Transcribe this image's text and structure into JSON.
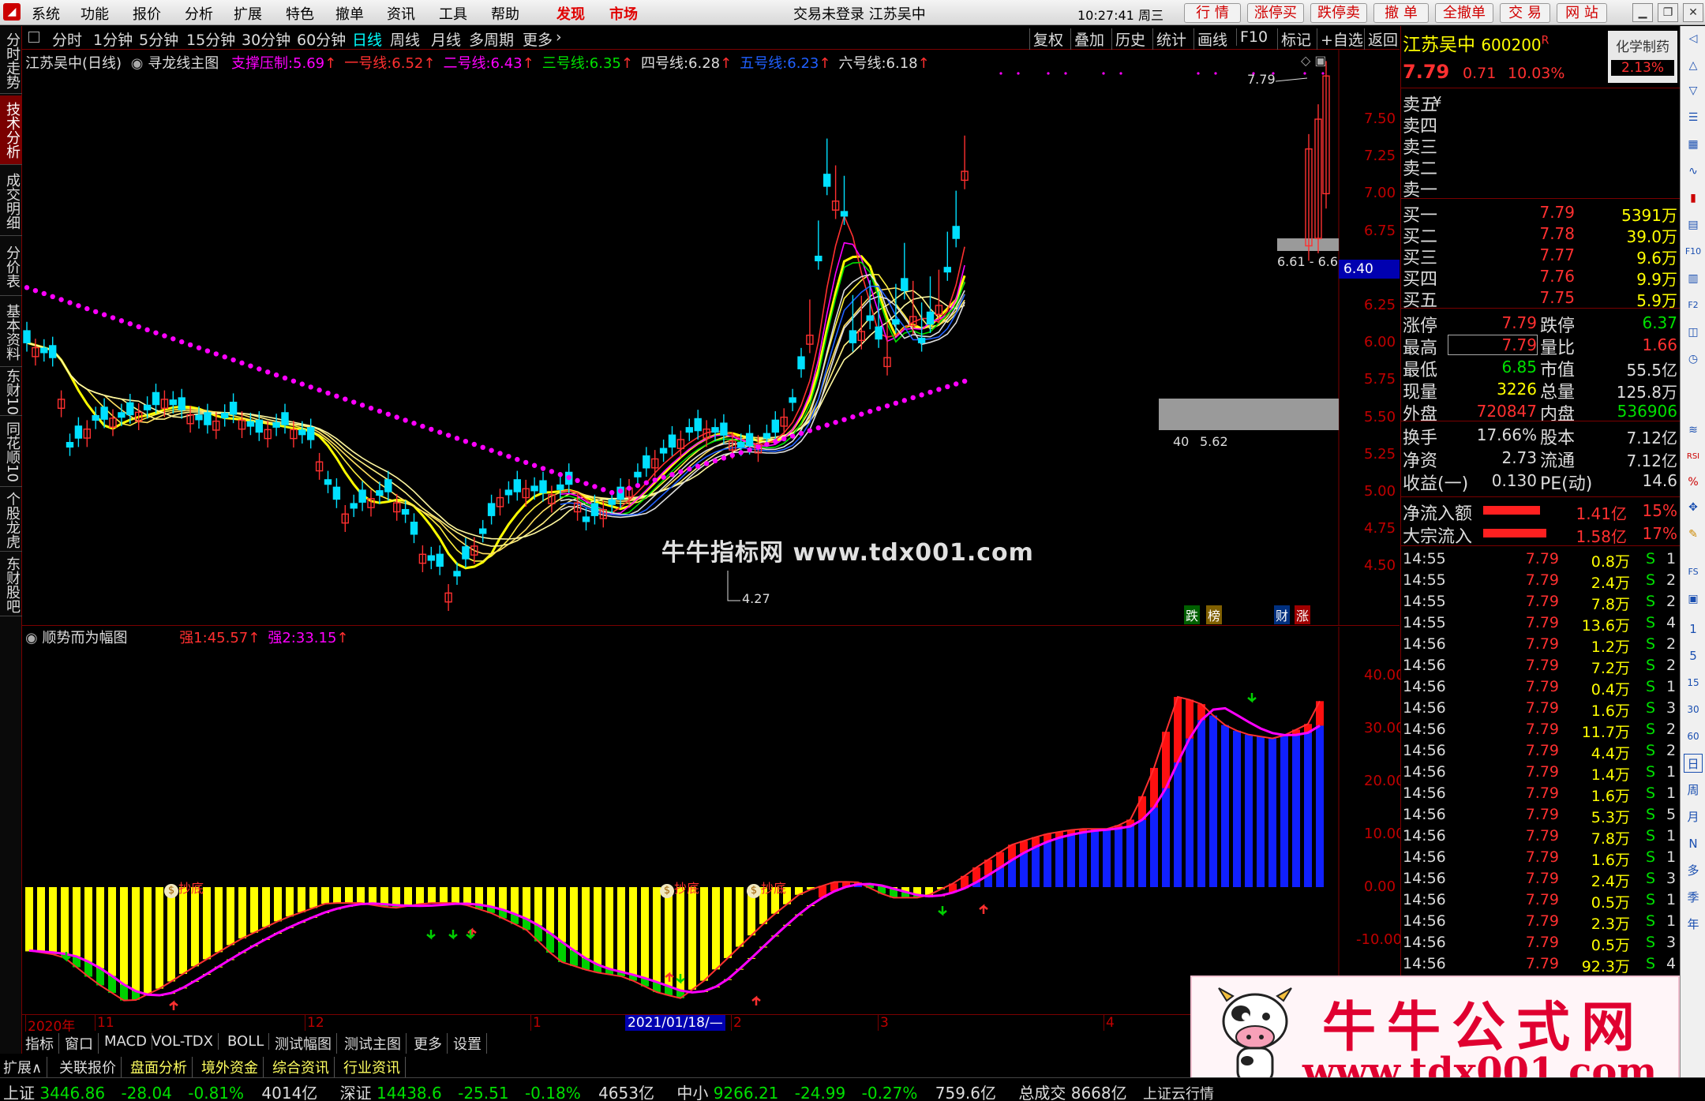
{
  "menubar": {
    "items": [
      "系统",
      "功能",
      "报价",
      "分析",
      "扩展",
      "特色",
      "撤单",
      "资讯",
      "工具",
      "帮助"
    ],
    "discover": "发现",
    "market": "市场",
    "center_title": "交易未登录  江苏吴中",
    "time": "10:27:41 周三",
    "buttons": [
      "行 情",
      "涨停买",
      "跌停卖",
      "撤 单",
      "全撤单",
      "交 易",
      "网 站"
    ]
  },
  "toolbar": {
    "periods": [
      "分时",
      "1分钟",
      "5分钟",
      "15分钟",
      "30分钟",
      "60分钟",
      "日线",
      "周线",
      "月线",
      "多周期",
      "更多"
    ],
    "active": "日线",
    "right": [
      "复权",
      "叠加",
      "历史",
      "统计",
      "画线",
      "F10",
      "标记",
      "+自选",
      "返回"
    ]
  },
  "left_tabs": [
    "分时走势",
    "技术分析",
    "成交明细",
    "分价表",
    "基本资料",
    "东财10",
    "同花顺10",
    "个股龙虎",
    "东财股吧"
  ],
  "main_chart": {
    "stock_title": "江苏吴中(日线)",
    "indicator_name": "寻龙线主图",
    "lines": [
      {
        "label": "支撑压制:",
        "value": "5.69",
        "color": "#ff00ff"
      },
      {
        "label": "一号线:",
        "value": "6.52",
        "color": "#ff3030"
      },
      {
        "label": "二号线:",
        "value": "6.43",
        "color": "#ff00ff"
      },
      {
        "label": "三号线:",
        "value": "6.35",
        "color": "#00e000"
      },
      {
        "label": "四号线:",
        "value": "6.28",
        "color": "#dddddd"
      },
      {
        "label": "五号线:",
        "value": "6.23",
        "color": "#2060ff"
      },
      {
        "label": "六号线:",
        "value": "6.18",
        "color": "#dddddd"
      }
    ],
    "y_ticks": [
      "7.50",
      "7.25",
      "7.00",
      "6.75",
      "6.50",
      "6.25",
      "6.00",
      "5.75",
      "5.50",
      "5.25",
      "5.00",
      "4.75",
      "4.50"
    ],
    "price_tag": "6.40",
    "annotations": {
      "high": "7.79",
      "low": "4.27",
      "box_top": "6.61 - 6.6",
      "box_low_left": "40",
      "box_low_right": "5.62"
    },
    "watermark": "牛牛指标网 www.tdx001.com",
    "badges": {
      "die": "跌",
      "bang": "榜",
      "cai": "财",
      "zhang": "涨"
    }
  },
  "sub_chart": {
    "indicator_name": "顺势而为幅图",
    "lines": [
      {
        "label": "强1:",
        "value": "45.57",
        "color": "#ff3030"
      },
      {
        "label": "强2:",
        "value": "33.15",
        "color": "#ff00ff"
      }
    ],
    "y_ticks": [
      "40.00",
      "30.00",
      "20.00",
      "10.00",
      "0.00",
      "-10.00"
    ],
    "signal_label": "抄底"
  },
  "x_axis": {
    "labels": [
      "2020年",
      "11",
      "12",
      "1",
      "2",
      "3",
      "4"
    ],
    "cursor_date": "2021/01/18/—"
  },
  "bottom_tabs": [
    "指标",
    "窗口",
    "MACD",
    "VOL-TDX",
    "BOLL",
    "测试幅图",
    "测试主图",
    "更多",
    "设置"
  ],
  "bottom_tabs2": [
    "扩展∧",
    "关联报价",
    "盘面分析",
    "境外资金",
    "综合资讯",
    "行业资讯"
  ],
  "quote": {
    "name": "江苏吴中",
    "code": "600200",
    "r_mark": "R",
    "sector": "化学制药",
    "price": "7.79",
    "change": "0.71",
    "pct": "10.03%",
    "sector_pct": "2.13%",
    "sell": [
      {
        "label": "卖五",
        "price": "",
        "vol": ""
      },
      {
        "label": "卖四",
        "price": "",
        "vol": ""
      },
      {
        "label": "卖三",
        "price": "",
        "vol": ""
      },
      {
        "label": "卖二",
        "price": "",
        "vol": ""
      },
      {
        "label": "卖一",
        "price": "",
        "vol": ""
      }
    ],
    "yen": "¥",
    "buy": [
      {
        "label": "买一",
        "price": "7.79",
        "vol": "5391万"
      },
      {
        "label": "买二",
        "price": "7.78",
        "vol": "39.0万"
      },
      {
        "label": "买三",
        "price": "7.77",
        "vol": "9.6万"
      },
      {
        "label": "买四",
        "price": "7.76",
        "vol": "9.9万"
      },
      {
        "label": "买五",
        "price": "7.75",
        "vol": "5.9万"
      }
    ],
    "stats": [
      [
        "涨停",
        "7.79",
        "跌停",
        "6.37"
      ],
      [
        "最高",
        "7.79",
        "量比",
        "1.66"
      ],
      [
        "最低",
        "6.85",
        "市值",
        "55.5亿"
      ],
      [
        "现量",
        "3226",
        "总量",
        "125.8万"
      ],
      [
        "外盘",
        "720847",
        "内盘",
        "536906"
      ]
    ],
    "stats2": [
      [
        "换手",
        "17.66%",
        "股本",
        "7.12亿"
      ],
      [
        "净资",
        "2.73",
        "流通",
        "7.12亿"
      ],
      [
        "收益(一)",
        "0.130",
        "PE(动)",
        "14.6"
      ]
    ],
    "flow": [
      {
        "label": "净流入额",
        "value": "1.41亿",
        "pct": "15%"
      },
      {
        "label": "大宗流入",
        "value": "1.58亿",
        "pct": "17%"
      }
    ]
  },
  "ticks": [
    [
      "14:55",
      "7.79",
      "0.8万",
      "S",
      "1"
    ],
    [
      "14:55",
      "7.79",
      "2.4万",
      "S",
      "2"
    ],
    [
      "14:55",
      "7.79",
      "7.8万",
      "S",
      "2"
    ],
    [
      "14:55",
      "7.79",
      "13.6万",
      "S",
      "4"
    ],
    [
      "14:56",
      "7.79",
      "1.2万",
      "S",
      "2"
    ],
    [
      "14:56",
      "7.79",
      "7.2万",
      "S",
      "2"
    ],
    [
      "14:56",
      "7.79",
      "0.4万",
      "S",
      "1"
    ],
    [
      "14:56",
      "7.79",
      "1.6万",
      "S",
      "3"
    ],
    [
      "14:56",
      "7.79",
      "11.7万",
      "S",
      "2"
    ],
    [
      "14:56",
      "7.79",
      "4.4万",
      "S",
      "2"
    ],
    [
      "14:56",
      "7.79",
      "1.4万",
      "S",
      "1"
    ],
    [
      "14:56",
      "7.79",
      "1.6万",
      "S",
      "1"
    ],
    [
      "14:56",
      "7.79",
      "5.3万",
      "S",
      "5"
    ],
    [
      "14:56",
      "7.79",
      "7.8万",
      "S",
      "1"
    ],
    [
      "14:56",
      "7.79",
      "1.6万",
      "S",
      "1"
    ],
    [
      "14:56",
      "7.79",
      "2.4万",
      "S",
      "3"
    ],
    [
      "14:56",
      "7.79",
      "0.5万",
      "S",
      "1"
    ],
    [
      "14:56",
      "7.79",
      "2.3万",
      "S",
      "1"
    ],
    [
      "14:56",
      "7.79",
      "0.5万",
      "S",
      "3"
    ],
    [
      "14:56",
      "7.79",
      "92.3万",
      "S",
      "4"
    ]
  ],
  "right_sidebar": [
    "1",
    "5",
    "15",
    "30",
    "60",
    "日",
    "周",
    "月",
    "N",
    "多",
    "季",
    "年"
  ],
  "status": {
    "sh_label": "上证",
    "sh": "3446.86",
    "sh_chg": "-28.04",
    "sh_pct": "-0.81%",
    "sh_amt": "4014亿",
    "sz_label": "深证",
    "sz": "14438.6",
    "sz_chg": "-25.51",
    "sz_pct": "-0.18%",
    "sz_amt": "4653亿",
    "zx_label": "中小",
    "zx": "9266.21",
    "zx_chg": "-24.99",
    "zx_pct": "-0.27%",
    "zx_amt": "759.6亿",
    "total_label": "总成交",
    "total": "8668亿",
    "tail": "上证云行情"
  },
  "ad": {
    "title": "牛牛公式网",
    "url": "www.tdx001.com"
  }
}
